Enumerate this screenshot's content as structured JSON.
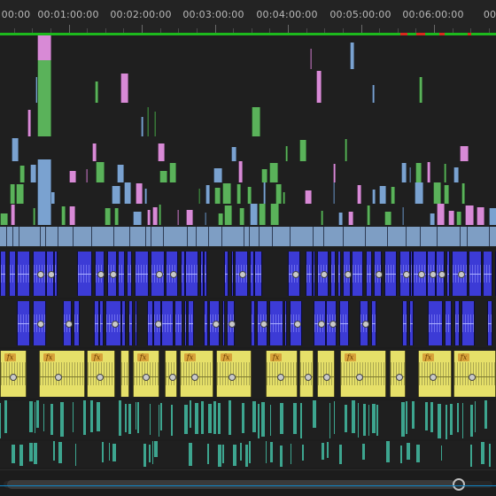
{
  "ruler": {
    "labels": [
      "00:00",
      "00:01:00:00",
      "00:02:00:00",
      "00:03:00:00",
      "00:04:00:00",
      "00:05:00:00",
      "00:06:00:00",
      "00:"
    ]
  },
  "colors": {
    "video_green": "#5ab25a",
    "video_pink": "#d88ad6",
    "video_blue": "#7aa2d0",
    "audio_blue": "#3c3bd6",
    "audio_yellow": "#e6e069",
    "audio_teal": "#3da58f",
    "work_area": "#1db91d",
    "render_red": "#d82a1e"
  },
  "icons": {
    "effect_badge": "fx-icon",
    "keyframe": "keyframe-icon",
    "scroll_handle": "zoom-handle-icon"
  },
  "effect_badge_text": "fx"
}
